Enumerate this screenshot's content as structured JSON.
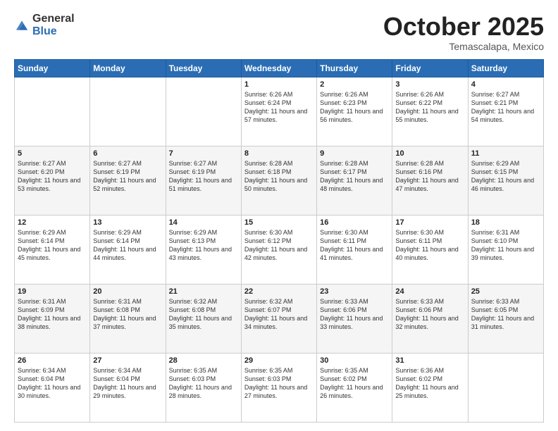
{
  "header": {
    "logo_general": "General",
    "logo_blue": "Blue",
    "month": "October 2025",
    "location": "Temascalapa, Mexico"
  },
  "days_of_week": [
    "Sunday",
    "Monday",
    "Tuesday",
    "Wednesday",
    "Thursday",
    "Friday",
    "Saturday"
  ],
  "weeks": [
    [
      {
        "day": "",
        "sunrise": "",
        "sunset": "",
        "daylight": ""
      },
      {
        "day": "",
        "sunrise": "",
        "sunset": "",
        "daylight": ""
      },
      {
        "day": "",
        "sunrise": "",
        "sunset": "",
        "daylight": ""
      },
      {
        "day": "1",
        "sunrise": "Sunrise: 6:26 AM",
        "sunset": "Sunset: 6:24 PM",
        "daylight": "Daylight: 11 hours and 57 minutes."
      },
      {
        "day": "2",
        "sunrise": "Sunrise: 6:26 AM",
        "sunset": "Sunset: 6:23 PM",
        "daylight": "Daylight: 11 hours and 56 minutes."
      },
      {
        "day": "3",
        "sunrise": "Sunrise: 6:26 AM",
        "sunset": "Sunset: 6:22 PM",
        "daylight": "Daylight: 11 hours and 55 minutes."
      },
      {
        "day": "4",
        "sunrise": "Sunrise: 6:27 AM",
        "sunset": "Sunset: 6:21 PM",
        "daylight": "Daylight: 11 hours and 54 minutes."
      }
    ],
    [
      {
        "day": "5",
        "sunrise": "Sunrise: 6:27 AM",
        "sunset": "Sunset: 6:20 PM",
        "daylight": "Daylight: 11 hours and 53 minutes."
      },
      {
        "day": "6",
        "sunrise": "Sunrise: 6:27 AM",
        "sunset": "Sunset: 6:19 PM",
        "daylight": "Daylight: 11 hours and 52 minutes."
      },
      {
        "day": "7",
        "sunrise": "Sunrise: 6:27 AM",
        "sunset": "Sunset: 6:19 PM",
        "daylight": "Daylight: 11 hours and 51 minutes."
      },
      {
        "day": "8",
        "sunrise": "Sunrise: 6:28 AM",
        "sunset": "Sunset: 6:18 PM",
        "daylight": "Daylight: 11 hours and 50 minutes."
      },
      {
        "day": "9",
        "sunrise": "Sunrise: 6:28 AM",
        "sunset": "Sunset: 6:17 PM",
        "daylight": "Daylight: 11 hours and 48 minutes."
      },
      {
        "day": "10",
        "sunrise": "Sunrise: 6:28 AM",
        "sunset": "Sunset: 6:16 PM",
        "daylight": "Daylight: 11 hours and 47 minutes."
      },
      {
        "day": "11",
        "sunrise": "Sunrise: 6:29 AM",
        "sunset": "Sunset: 6:15 PM",
        "daylight": "Daylight: 11 hours and 46 minutes."
      }
    ],
    [
      {
        "day": "12",
        "sunrise": "Sunrise: 6:29 AM",
        "sunset": "Sunset: 6:14 PM",
        "daylight": "Daylight: 11 hours and 45 minutes."
      },
      {
        "day": "13",
        "sunrise": "Sunrise: 6:29 AM",
        "sunset": "Sunset: 6:14 PM",
        "daylight": "Daylight: 11 hours and 44 minutes."
      },
      {
        "day": "14",
        "sunrise": "Sunrise: 6:29 AM",
        "sunset": "Sunset: 6:13 PM",
        "daylight": "Daylight: 11 hours and 43 minutes."
      },
      {
        "day": "15",
        "sunrise": "Sunrise: 6:30 AM",
        "sunset": "Sunset: 6:12 PM",
        "daylight": "Daylight: 11 hours and 42 minutes."
      },
      {
        "day": "16",
        "sunrise": "Sunrise: 6:30 AM",
        "sunset": "Sunset: 6:11 PM",
        "daylight": "Daylight: 11 hours and 41 minutes."
      },
      {
        "day": "17",
        "sunrise": "Sunrise: 6:30 AM",
        "sunset": "Sunset: 6:11 PM",
        "daylight": "Daylight: 11 hours and 40 minutes."
      },
      {
        "day": "18",
        "sunrise": "Sunrise: 6:31 AM",
        "sunset": "Sunset: 6:10 PM",
        "daylight": "Daylight: 11 hours and 39 minutes."
      }
    ],
    [
      {
        "day": "19",
        "sunrise": "Sunrise: 6:31 AM",
        "sunset": "Sunset: 6:09 PM",
        "daylight": "Daylight: 11 hours and 38 minutes."
      },
      {
        "day": "20",
        "sunrise": "Sunrise: 6:31 AM",
        "sunset": "Sunset: 6:08 PM",
        "daylight": "Daylight: 11 hours and 37 minutes."
      },
      {
        "day": "21",
        "sunrise": "Sunrise: 6:32 AM",
        "sunset": "Sunset: 6:08 PM",
        "daylight": "Daylight: 11 hours and 35 minutes."
      },
      {
        "day": "22",
        "sunrise": "Sunrise: 6:32 AM",
        "sunset": "Sunset: 6:07 PM",
        "daylight": "Daylight: 11 hours and 34 minutes."
      },
      {
        "day": "23",
        "sunrise": "Sunrise: 6:33 AM",
        "sunset": "Sunset: 6:06 PM",
        "daylight": "Daylight: 11 hours and 33 minutes."
      },
      {
        "day": "24",
        "sunrise": "Sunrise: 6:33 AM",
        "sunset": "Sunset: 6:06 PM",
        "daylight": "Daylight: 11 hours and 32 minutes."
      },
      {
        "day": "25",
        "sunrise": "Sunrise: 6:33 AM",
        "sunset": "Sunset: 6:05 PM",
        "daylight": "Daylight: 11 hours and 31 minutes."
      }
    ],
    [
      {
        "day": "26",
        "sunrise": "Sunrise: 6:34 AM",
        "sunset": "Sunset: 6:04 PM",
        "daylight": "Daylight: 11 hours and 30 minutes."
      },
      {
        "day": "27",
        "sunrise": "Sunrise: 6:34 AM",
        "sunset": "Sunset: 6:04 PM",
        "daylight": "Daylight: 11 hours and 29 minutes."
      },
      {
        "day": "28",
        "sunrise": "Sunrise: 6:35 AM",
        "sunset": "Sunset: 6:03 PM",
        "daylight": "Daylight: 11 hours and 28 minutes."
      },
      {
        "day": "29",
        "sunrise": "Sunrise: 6:35 AM",
        "sunset": "Sunset: 6:03 PM",
        "daylight": "Daylight: 11 hours and 27 minutes."
      },
      {
        "day": "30",
        "sunrise": "Sunrise: 6:35 AM",
        "sunset": "Sunset: 6:02 PM",
        "daylight": "Daylight: 11 hours and 26 minutes."
      },
      {
        "day": "31",
        "sunrise": "Sunrise: 6:36 AM",
        "sunset": "Sunset: 6:02 PM",
        "daylight": "Daylight: 11 hours and 25 minutes."
      },
      {
        "day": "",
        "sunrise": "",
        "sunset": "",
        "daylight": ""
      }
    ]
  ]
}
